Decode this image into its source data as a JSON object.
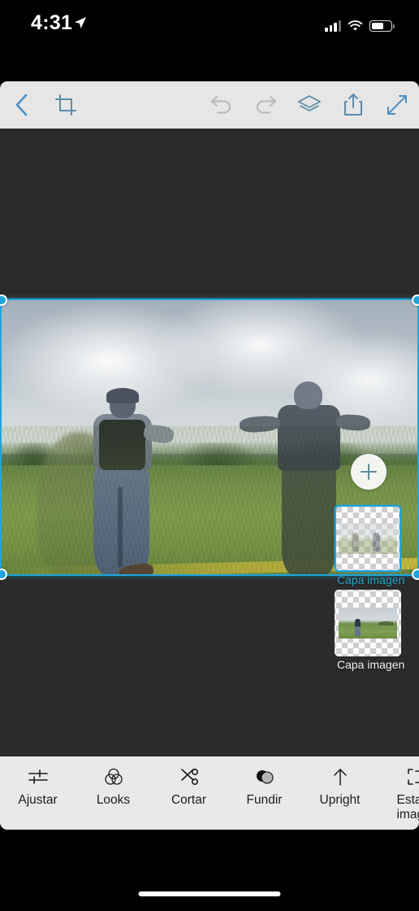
{
  "status_bar": {
    "time": "4:31",
    "location_icon": "location-arrow-icon",
    "signal_icon": "cellular-signal-icon",
    "wifi_icon": "wifi-icon",
    "battery_icon": "battery-icon",
    "battery_level": "62%"
  },
  "top_toolbar": {
    "background": "#e6e6e6",
    "accent": "#5d8ba8",
    "items": [
      {
        "name": "back-button",
        "icon": "chevron-left-icon",
        "enabled": true
      },
      {
        "name": "crop-button",
        "icon": "crop-icon",
        "enabled": true
      },
      {
        "name": "undo-button",
        "icon": "undo-arrow-icon",
        "enabled": false
      },
      {
        "name": "redo-button",
        "icon": "redo-arrow-icon",
        "enabled": false
      },
      {
        "name": "layers-button",
        "icon": "layers-stack-icon",
        "enabled": true
      },
      {
        "name": "share-button",
        "icon": "share-export-icon",
        "enabled": true
      },
      {
        "name": "fullscreen-button",
        "icon": "expand-diagonal-icon",
        "enabled": true
      }
    ]
  },
  "canvas": {
    "background": "#2b2b2b",
    "selection_color": "#1fa5dd",
    "photo_description": "Double exposure of two people walking in a green field under a cloudy sky",
    "handles": [
      "top-left",
      "top-right",
      "bottom-left",
      "bottom-right"
    ]
  },
  "layers_panel": {
    "add_button_icon": "plus-icon",
    "selected_index": 0,
    "items": [
      {
        "label": "Capa imagen",
        "selected": true
      },
      {
        "label": "Capa imagen",
        "selected": false
      }
    ]
  },
  "bottom_toolbar": {
    "background": "#e9e9e9",
    "items": [
      {
        "label": "Ajustar",
        "icon": "sliders-icon"
      },
      {
        "label": "Looks",
        "icon": "venn-circles-icon"
      },
      {
        "label": "Cortar",
        "icon": "scissors-icon"
      },
      {
        "label": "Fundir",
        "icon": "blend-circles-icon"
      },
      {
        "label": "Upright",
        "icon": "up-arrow-icon"
      },
      {
        "label": "Estado imagen",
        "icon": "image-state-icon"
      }
    ]
  }
}
